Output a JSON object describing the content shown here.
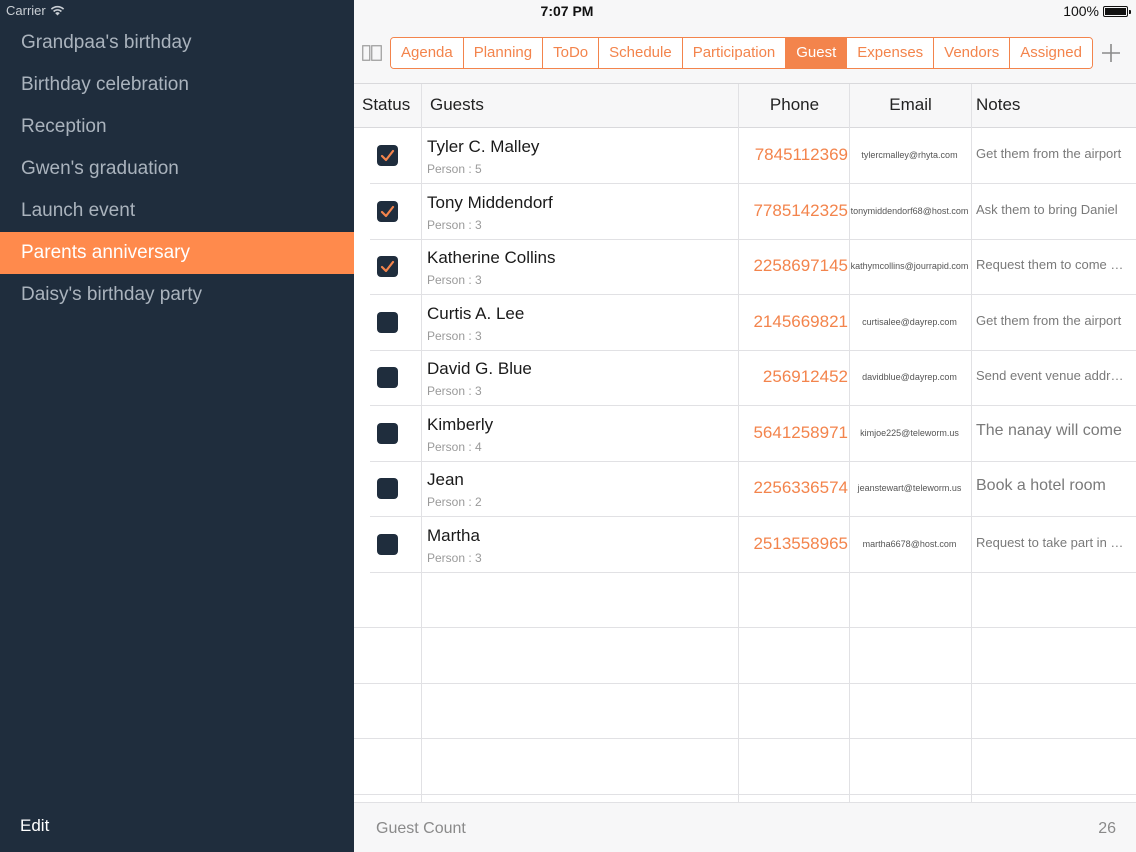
{
  "status_bar": {
    "carrier": "Carrier",
    "time": "7:07 PM",
    "battery": "100%"
  },
  "sidebar": {
    "events": [
      {
        "label": "Grandpaa's birthday",
        "selected": false
      },
      {
        "label": "Birthday celebration",
        "selected": false
      },
      {
        "label": "Reception",
        "selected": false
      },
      {
        "label": "Gwen's graduation",
        "selected": false
      },
      {
        "label": "Launch event",
        "selected": false
      },
      {
        "label": "Parents anniversary",
        "selected": true
      },
      {
        "label": "Daisy's birthday party",
        "selected": false
      }
    ],
    "edit_label": "Edit"
  },
  "tabs": [
    {
      "label": "Agenda",
      "active": false
    },
    {
      "label": "Planning",
      "active": false
    },
    {
      "label": "ToDo",
      "active": false
    },
    {
      "label": "Schedule",
      "active": false
    },
    {
      "label": "Participation",
      "active": false
    },
    {
      "label": "Guest",
      "active": true
    },
    {
      "label": "Expenses",
      "active": false
    },
    {
      "label": "Vendors",
      "active": false
    },
    {
      "label": "Assigned",
      "active": false
    }
  ],
  "table": {
    "headers": {
      "status": "Status",
      "guests": "Guests",
      "phone": "Phone",
      "email": "Email",
      "notes": "Notes"
    },
    "rows": [
      {
        "checked": true,
        "name": "Tyler C. Malley",
        "persons": "Person : 5",
        "phone": "7845112369",
        "email": "tylercmalley@rhyta.com",
        "notes": "Get them from the airport"
      },
      {
        "checked": true,
        "name": "Tony Middendorf",
        "persons": "Person : 3",
        "phone": "7785142325",
        "email": "tonymiddendorf68@host.com",
        "notes": "Ask them to bring Daniel"
      },
      {
        "checked": true,
        "name": "Katherine Collins",
        "persons": "Person : 3",
        "phone": "2258697145",
        "email": "kathymcollins@jourrapid.com",
        "notes": "Request them to come early"
      },
      {
        "checked": false,
        "name": "Curtis A. Lee",
        "persons": "Person : 3",
        "phone": "2145669821",
        "email": "curtisalee@dayrep.com",
        "notes": "Get them from the airport"
      },
      {
        "checked": false,
        "name": "David G. Blue",
        "persons": "Person : 3",
        "phone": "256912452",
        "email": "davidblue@dayrep.com",
        "notes": "Send event venue address"
      },
      {
        "checked": false,
        "name": "Kimberly",
        "persons": "Person : 4",
        "phone": "5641258971",
        "email": "kimjoe225@teleworm.us",
        "notes": "The nanay will come"
      },
      {
        "checked": false,
        "name": "Jean",
        "persons": "Person : 2",
        "phone": "2256336574",
        "email": "jeanstewart@teleworm.us",
        "notes": "Book a hotel room"
      },
      {
        "checked": false,
        "name": "Martha",
        "persons": "Person : 3",
        "phone": "2513558965",
        "email": "martha6678@host.com",
        "notes": "Request to take part in games"
      }
    ]
  },
  "footer": {
    "label": "Guest Count",
    "count": "26"
  },
  "colors": {
    "accent": "#f3844c",
    "sidebar_bg": "#1f2d3d",
    "selected_bg": "#ff8a4c"
  },
  "icons": {
    "sidebar_toggle": "sidebar-toggle-icon",
    "add": "plus-icon",
    "check": "checkmark-icon",
    "wifi": "wifi-icon",
    "battery": "battery-icon"
  }
}
